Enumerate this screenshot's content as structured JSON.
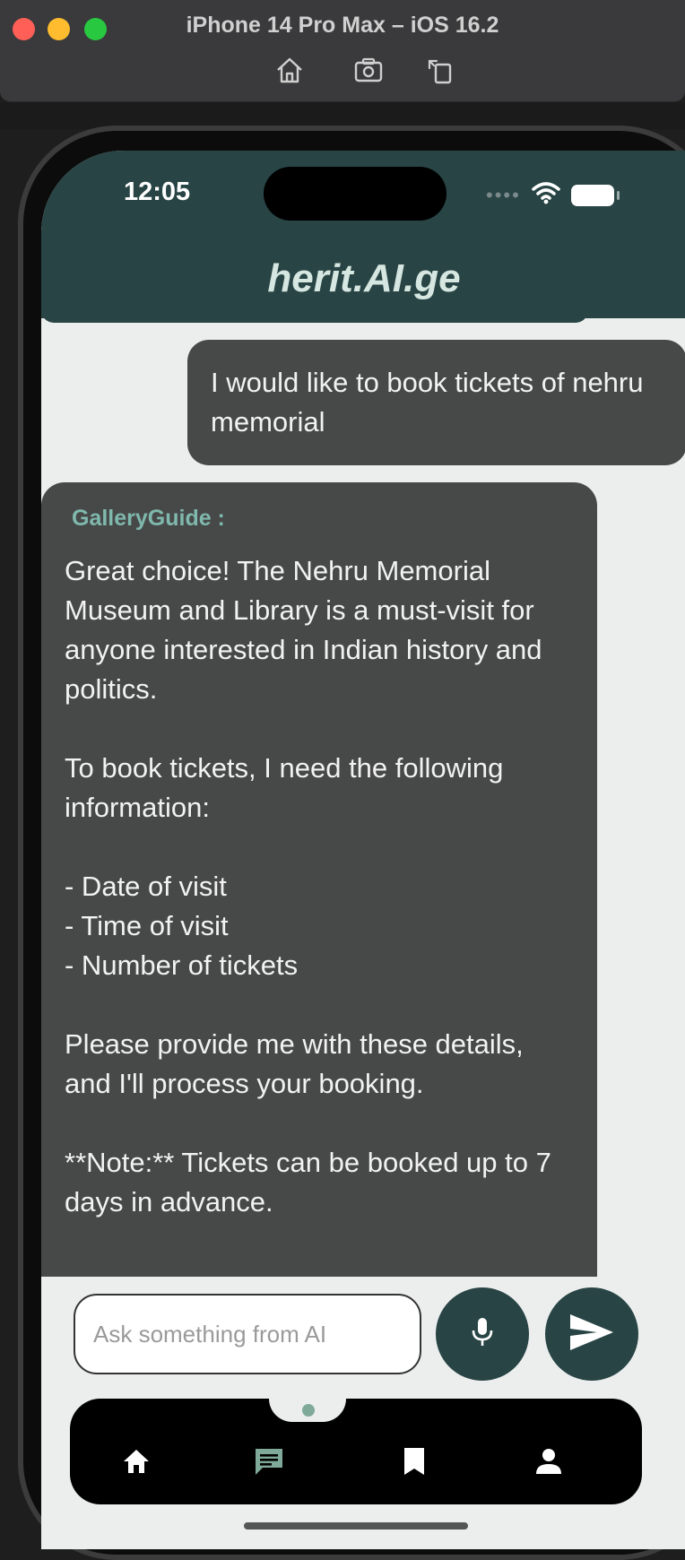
{
  "simulator": {
    "title": "iPhone 14 Pro Max – iOS 16.2",
    "icons": [
      "home-icon",
      "screenshot-icon",
      "rotate-icon"
    ]
  },
  "status_bar": {
    "time": "12:05",
    "icons": [
      "cellular-dots-icon",
      "wifi-icon",
      "battery-icon"
    ]
  },
  "app": {
    "title": "herit.AI.ge"
  },
  "messages": [
    {
      "role": "user",
      "text": "I would like to book tickets of nehru memorial"
    },
    {
      "role": "assistant",
      "sender": "GalleryGuide :",
      "text": "Great choice! The Nehru Memorial Museum and Library is a must-visit for anyone interested in Indian history and politics.\n\nTo book tickets, I need the following information:\n\n- Date of visit\n- Time of visit\n- Number of tickets\n\nPlease provide me with these details, and I'll process your booking.\n\n**Note:** Tickets can be booked up to 7 days in advance."
    }
  ],
  "composer": {
    "placeholder": "Ask something from AI",
    "value": ""
  },
  "nav": {
    "items": [
      "home-icon",
      "chat-icon",
      "bookmark-icon",
      "profile-icon"
    ],
    "active": "chat-icon"
  },
  "colors": {
    "header": "#284444",
    "bubble": "#474848",
    "sender_name": "#7fb8ac",
    "background": "#eceeee",
    "active_nav": "#7faa9a"
  }
}
